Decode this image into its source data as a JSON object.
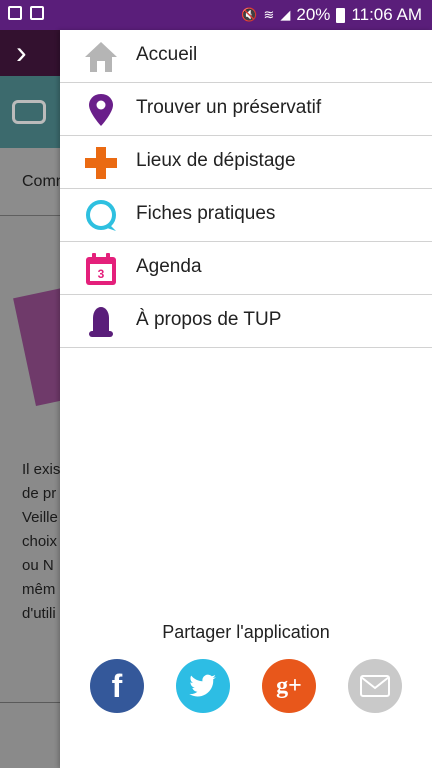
{
  "status_bar": {
    "battery": "20%",
    "time": "11:06 AM",
    "icons": [
      "gallery-icon",
      "photo-icon",
      "mute-icon",
      "wifi-icon",
      "signal-icon",
      "battery-icon"
    ]
  },
  "background_screen": {
    "back_icon": "chevron-right-icon",
    "tab_label": "Comm",
    "body_lines": [
      "Il exis",
      "de pr",
      "Veille",
      "choix",
      "ou N",
      "mêm",
      "d'utili"
    ]
  },
  "drawer": {
    "menu": [
      {
        "label": "Accueil",
        "icon": "home-icon",
        "color": "#b5b5b5"
      },
      {
        "label": "Trouver un préservatif",
        "icon": "location-pin-icon",
        "color": "#6a1f8a"
      },
      {
        "label": "Lieux de dépistage",
        "icon": "medical-cross-icon",
        "color": "#ea6a12"
      },
      {
        "label": "Fiches pratiques",
        "icon": "chat-bubble-icon",
        "color": "#2ec0e0"
      },
      {
        "label": "Agenda",
        "icon": "calendar-icon",
        "color": "#e4207b",
        "badge": "3"
      },
      {
        "label": "À propos de TUP",
        "icon": "condom-icon",
        "color": "#5a1e7a"
      }
    ],
    "share": {
      "label": "Partager l'application",
      "buttons": [
        {
          "name": "facebook",
          "icon": "facebook-icon",
          "glyph": "f",
          "color": "#34589a"
        },
        {
          "name": "twitter",
          "icon": "twitter-icon",
          "glyph": "🐦",
          "color": "#2dbde4"
        },
        {
          "name": "google-plus",
          "icon": "google-plus-icon",
          "glyph": "g+",
          "color": "#e8571b"
        },
        {
          "name": "email",
          "icon": "email-icon",
          "glyph": "✉",
          "color": "#c9c9c9"
        }
      ]
    }
  }
}
